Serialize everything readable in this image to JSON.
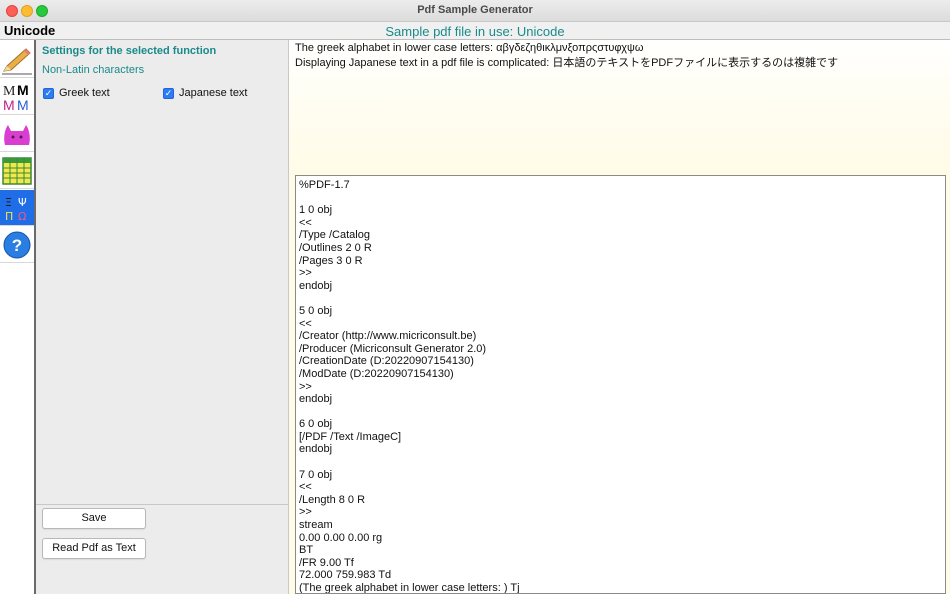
{
  "window": {
    "title": "Pdf Sample Generator"
  },
  "header": {
    "app_name": "Unicode",
    "file_in_use": "Sample pdf file in use: Unicode"
  },
  "toolbar": {
    "icons": [
      "pencil-icon",
      "font-styles-icon",
      "cat-icon",
      "table-icon",
      "unicode-icon",
      "help-icon"
    ],
    "active": "unicode-icon",
    "active_color": "#1f6ee8"
  },
  "settings": {
    "title": "Settings for the selected function",
    "subtitle": "Non-Latin characters",
    "greek_label": "Greek text",
    "greek_checked": true,
    "japanese_label": "Japanese text",
    "japanese_checked": true,
    "save_label": "Save",
    "read_label": "Read Pdf as Text"
  },
  "preview": {
    "line1": "The greek alphabet in lower case letters: αβγδεζηθικλμνξοπρςστυφχψω",
    "line2": "Displaying Japanese text in a pdf file is complicated: 日本語のテキストをPDFファイルに表示するのは複雑です"
  },
  "source_lines": [
    "%PDF-1.7",
    "",
    "1 0 obj",
    "<<",
    "/Type /Catalog",
    "/Outlines 2 0 R",
    "/Pages 3 0 R",
    ">>",
    "endobj",
    "",
    "5 0 obj",
    "<<",
    "/Creator (http://www.micriconsult.be)",
    "/Producer (Micriconsult Generator 2.0)",
    "/CreationDate (D:20220907154130)",
    "/ModDate (D:20220907154130)",
    ">>",
    "endobj",
    "",
    "6 0 obj",
    "[/PDF /Text /ImageC]",
    "endobj",
    "",
    "7 0 obj",
    "<<",
    "/Length 8 0 R",
    ">>",
    "stream",
    "0.00 0.00 0.00 rg",
    "BT",
    "/FR 9.00 Tf",
    "72.000 759.983 Td",
    "(The greek alphabet in lower case letters: ) Tj"
  ],
  "colors": {
    "accent": "#1a8a8a",
    "checkbox": "#2d7cf6"
  }
}
